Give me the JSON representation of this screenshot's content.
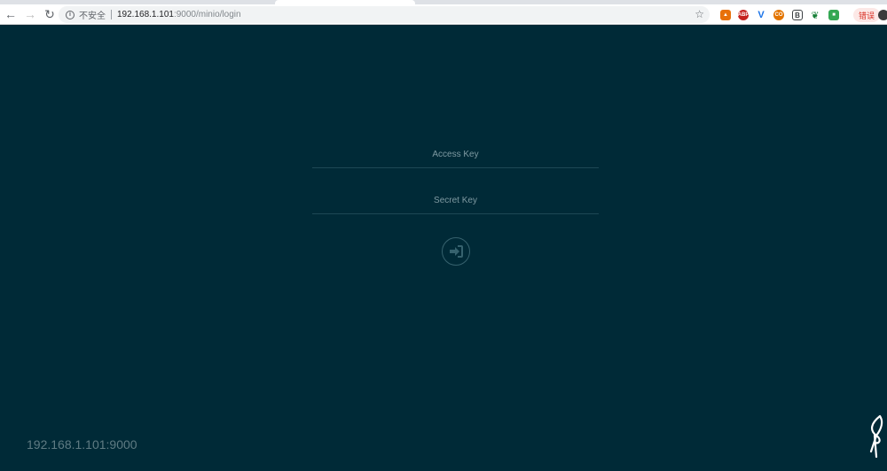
{
  "browser": {
    "back_icon": "arrow-left-icon",
    "forward_icon": "arrow-right-icon",
    "reload_icon": "reload-icon",
    "security_label": "不安全",
    "url_host": "192.168.1.101",
    "url_path": ":9000/minio/login",
    "bookmark_icon": "star-icon",
    "extensions": [
      {
        "name": "ext-network-icon",
        "color": "#e8710a"
      },
      {
        "name": "ext-adblock-icon",
        "label": "ABP",
        "color": "#c5221f"
      },
      {
        "name": "ext-vue-icon",
        "color": "#1a73e8"
      },
      {
        "name": "ext-orange-icon",
        "label": "CO",
        "color": "#e37400"
      },
      {
        "name": "ext-dark-icon",
        "color": "#3c4043"
      },
      {
        "name": "ext-leaf-icon",
        "color": "#188038"
      },
      {
        "name": "ext-colorful-icon",
        "color": "#34a853"
      }
    ],
    "error_label": "错误"
  },
  "login": {
    "access_key_placeholder": "Access Key",
    "secret_key_placeholder": "Secret Key",
    "submit_icon": "sign-in-icon"
  },
  "footer": {
    "host": "192.168.1.101:9000",
    "logo_icon": "minio-logo-icon"
  },
  "colors": {
    "background": "#002a37",
    "input_border": "#1e4854",
    "placeholder": "#7f9aa2",
    "host_text": "#5f7b83"
  }
}
